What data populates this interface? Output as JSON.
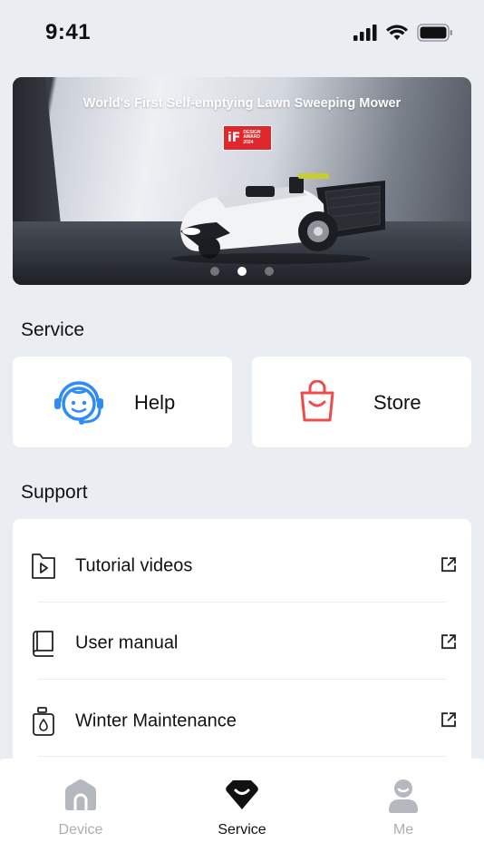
{
  "status_bar": {
    "time": "9:41"
  },
  "banner": {
    "headline": "World's First Self-emptying Lawn Sweeping Mower",
    "award_logo": "iF",
    "award_lines": [
      "DESIGN",
      "AWARD",
      "2024"
    ],
    "slides": 3,
    "active_slide": 2
  },
  "service": {
    "title": "Service",
    "items": [
      {
        "label": "Help",
        "icon": "support-agent-icon"
      },
      {
        "label": "Store",
        "icon": "shopping-bag-icon"
      }
    ]
  },
  "support": {
    "title": "Support",
    "items": [
      {
        "label": "Tutorial videos",
        "icon": "video-file-icon"
      },
      {
        "label": "User manual",
        "icon": "book-icon"
      },
      {
        "label": "Winter Maintenance",
        "icon": "canister-icon"
      }
    ]
  },
  "tabs": [
    {
      "label": "Device",
      "icon": "home-icon",
      "active": false
    },
    {
      "label": "Service",
      "icon": "heart-badge-icon",
      "active": true
    },
    {
      "label": "Me",
      "icon": "person-icon",
      "active": false
    }
  ],
  "colors": {
    "background": "#eaeef3",
    "help_icon": "#2f8cf6",
    "store_icon": "#f04b4b",
    "tab_active": "#111111",
    "tab_inactive": "#a9aeb5"
  }
}
